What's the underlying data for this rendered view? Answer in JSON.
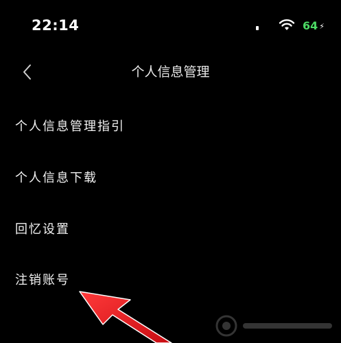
{
  "status_bar": {
    "time": "22:14",
    "battery_level": "64",
    "battery_color": "#4cd964"
  },
  "nav": {
    "back_icon": "chevron-left-icon",
    "title": "个人信息管理"
  },
  "menu": {
    "items": [
      {
        "label": "个人信息管理指引"
      },
      {
        "label": "个人信息下载"
      },
      {
        "label": "回忆设置"
      },
      {
        "label": "注销账号"
      }
    ]
  },
  "annotation": {
    "arrow_color": "#e8141b"
  }
}
